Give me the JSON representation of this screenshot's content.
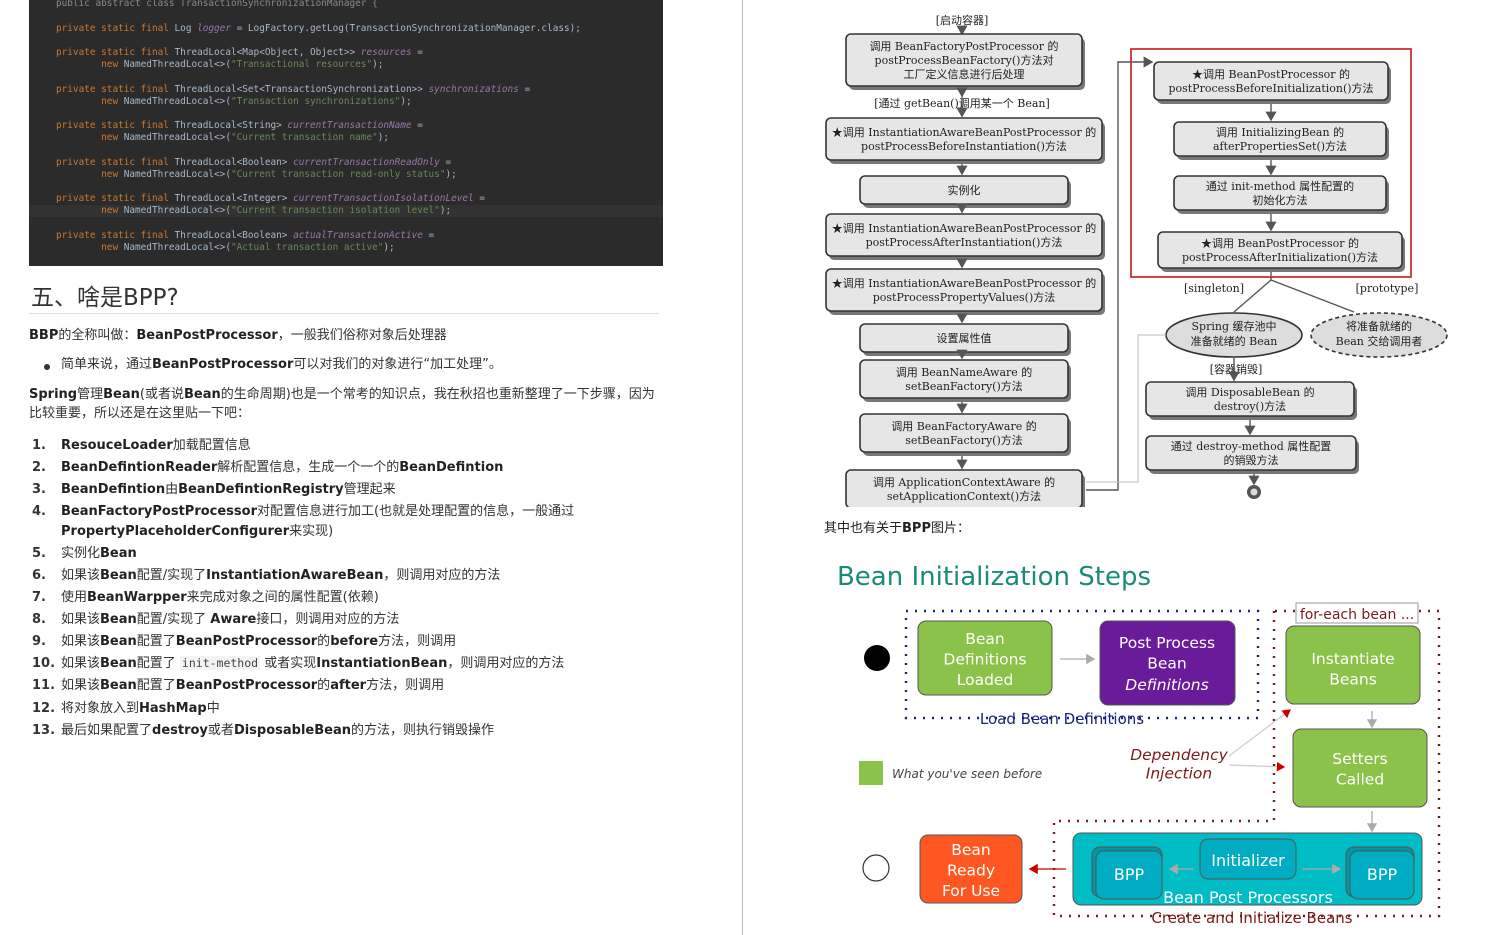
{
  "code": {
    "top_line": "public abstract class TransactionSynchronizationManager {",
    "lines": [
      [
        "private static final",
        "Log",
        "logger",
        "= LogFactory.getLog(TransactionSynchronizationManager.class);",
        ""
      ],
      [
        "private static final",
        "ThreadLocal<Map<Object, Object>>",
        "resources",
        "=",
        "new NamedThreadLocal<>(\"Transactional resources\");"
      ],
      [
        "private static final",
        "ThreadLocal<Set<TransactionSynchronization>>",
        "synchronizations",
        "=",
        "new NamedThreadLocal<>(\"Transaction synchronizations\");"
      ],
      [
        "private static final",
        "ThreadLocal<String>",
        "currentTransactionName",
        "=",
        "new NamedThreadLocal<>(\"Current transaction name\");"
      ],
      [
        "private static final",
        "ThreadLocal<Boolean>",
        "currentTransactionReadOnly",
        "=",
        "new NamedThreadLocal<>(\"Current transaction read-only status\");"
      ],
      [
        "private static final",
        "ThreadLocal<Integer>",
        "currentTransactionIsolationLevel",
        "=",
        "new NamedThreadLocal<>(\"Current transaction isolation level\");"
      ],
      [
        "private static final",
        "ThreadLocal<Boolean>",
        "actualTransactionActive",
        "=",
        "new NamedThreadLocal<>(\"Actual transaction active\");"
      ]
    ]
  },
  "heading": "五、啥是BPP?",
  "intro": {
    "bbp": "BBP",
    "t1": "的全称叫做：",
    "bpp": "BeanPostProcessor",
    "t2": "，一般我们俗称对象后处理器"
  },
  "bullet": {
    "t1": "简单来说，通过",
    "bpp": "BeanPostProcessor",
    "t2": "可以对我们的对象进行“加工处理”。"
  },
  "para": {
    "spring": "Spring",
    "t1": "管理",
    "bean": "Bean",
    "t2": "(或者说",
    "bean2": "Bean",
    "t3": "的生命周期)也是一个常考的知识点，我在秋招也重新整理了一下步骤，因为比较重要，所以还是在这里贴一下吧："
  },
  "steps": [
    {
      "n": "1.",
      "parts": [
        [
          "b",
          "ResouceLoader"
        ],
        [
          "t",
          "加载配置信息"
        ]
      ]
    },
    {
      "n": "2.",
      "parts": [
        [
          "b",
          "BeanDefintionReader"
        ],
        [
          "t",
          "解析配置信息，生成一个一个的"
        ],
        [
          "b",
          "BeanDefintion"
        ]
      ]
    },
    {
      "n": "3.",
      "parts": [
        [
          "b",
          "BeanDefintion"
        ],
        [
          "t",
          "由"
        ],
        [
          "b",
          "BeanDefintionRegistry"
        ],
        [
          "t",
          "管理起来"
        ]
      ]
    },
    {
      "n": "4.",
      "parts": [
        [
          "b",
          "BeanFactoryPostProcessor"
        ],
        [
          "t",
          "对配置信息进行加工(也就是处理配置的信息，一般通过"
        ],
        [
          "b",
          "PropertyPlaceholderConfigurer"
        ],
        [
          "t",
          "来实现)"
        ]
      ]
    },
    {
      "n": "5.",
      "parts": [
        [
          "t",
          "实例化"
        ],
        [
          "b",
          "Bean"
        ]
      ]
    },
    {
      "n": "6.",
      "parts": [
        [
          "t",
          "如果该"
        ],
        [
          "b",
          "Bean"
        ],
        [
          "t",
          "配置/实现了"
        ],
        [
          "b",
          "InstantiationAwareBean"
        ],
        [
          "t",
          "，则调用对应的方法"
        ]
      ]
    },
    {
      "n": "7.",
      "parts": [
        [
          "t",
          "使用"
        ],
        [
          "b",
          "BeanWarpper"
        ],
        [
          "t",
          "来完成对象之间的属性配置(依赖)"
        ]
      ]
    },
    {
      "n": "8.",
      "parts": [
        [
          "t",
          "如果该"
        ],
        [
          "b",
          "Bean"
        ],
        [
          "t",
          "配置/实现了 "
        ],
        [
          "b",
          "Aware"
        ],
        [
          "t",
          "接口，则调用对应的方法"
        ]
      ]
    },
    {
      "n": "9.",
      "parts": [
        [
          "t",
          "如果该"
        ],
        [
          "b",
          "Bean"
        ],
        [
          "t",
          "配置了"
        ],
        [
          "b",
          "BeanPostProcessor"
        ],
        [
          "t",
          "的"
        ],
        [
          "b",
          "before"
        ],
        [
          "t",
          "方法，则调用"
        ]
      ]
    },
    {
      "n": "10.",
      "parts": [
        [
          "t",
          "如果该"
        ],
        [
          "b",
          "Bean"
        ],
        [
          "t",
          "配置了 "
        ],
        [
          "c",
          "init-method"
        ],
        [
          "t",
          " 或者实现"
        ],
        [
          "b",
          "InstantiationBean"
        ],
        [
          "t",
          "，则调用对应的方法"
        ]
      ]
    },
    {
      "n": "11.",
      "parts": [
        [
          "t",
          "如果该"
        ],
        [
          "b",
          "Bean"
        ],
        [
          "t",
          "配置了"
        ],
        [
          "b",
          "BeanPostProcessor"
        ],
        [
          "t",
          "的"
        ],
        [
          "b",
          "after"
        ],
        [
          "t",
          "方法，则调用"
        ]
      ]
    },
    {
      "n": "12.",
      "parts": [
        [
          "t",
          "将对象放入到"
        ],
        [
          "b",
          "HashMap"
        ],
        [
          "t",
          "中"
        ]
      ]
    },
    {
      "n": "13.",
      "parts": [
        [
          "t",
          "最后如果配置了"
        ],
        [
          "b",
          "destroy"
        ],
        [
          "t",
          "或者"
        ],
        [
          "b",
          "DisposableBean"
        ],
        [
          "t",
          "的方法，则执行销毁操作"
        ]
      ]
    }
  ],
  "flow": {
    "start": "[启动容器]",
    "left": [
      "调用 BeanFactoryPostProcessor 的|postProcessBeanFactory()方法对|工厂定义信息进行后处理",
      "★调用 InstantiationAwareBeanPostProcessor 的|postProcessBeforeInstantiation()方法",
      "实例化",
      "★调用 InstantiationAwareBeanPostProcessor 的|postProcessAfterInstantiation()方法",
      "★调用 InstantiationAwareBeanPostProcessor 的|postProcessPropertyValues()方法",
      "设置属性值",
      "调用 BeanNameAware 的|setBeanFactory()方法",
      "调用 BeanFactoryAware 的|setBeanFactory()方法",
      "调用 ApplicationContextAware 的|setApplicationContext()方法"
    ],
    "getbean": "[通过 getBean()调用某一个 Bean]",
    "right": [
      "★调用 BeanPostProcessor 的|postProcessBeforeInitialization()方法",
      "调用 InitializingBean 的|afterPropertiesSet()方法",
      "通过 init-method 属性配置的|初始化方法",
      "★调用 BeanPostProcessor 的|postProcessAfterInitialization()方法"
    ],
    "singleton": "[singleton]",
    "prototype": "[prototype]",
    "pool": "Spring 缓存池中|准备就绪的 Bean",
    "deliver": "将准备就绪的|Bean 交给调用者",
    "destroy_label": "[容器销毁]",
    "bottom": [
      "调用 DisposableBean 的|destroy()方法",
      "通过 destroy-method 属性配置|的销毁方法"
    ]
  },
  "caption": {
    "t1": "其中也有关于",
    "bpp": "BPP",
    "t2": "图片："
  },
  "init": {
    "title": "Bean Initialization Steps",
    "defs_loaded": "Bean|Definitions|Loaded",
    "post_process": "Post Process|Bean",
    "definitions": "Definitions",
    "load_label": "Load Bean Definitions",
    "foreach": "for-each bean ...",
    "instantiate": "Instantiate|Beans",
    "setters": "Setters|Called",
    "di": "Dependency|Injection",
    "seen": "What you've seen before",
    "ready": "Bean|Ready|For Use",
    "bpp1": "BPP",
    "initializer": "Initializer",
    "bpp2": "BPP",
    "bpps": "Bean Post Processors",
    "create": "Create and Initialize Beans",
    "colors": {
      "green": "#8bc34a",
      "purple": "#6a1b9a",
      "orange": "#ff5722",
      "teal": "#00bcc4",
      "title": "#1b8a7a",
      "navy": "#1a237e",
      "maroon": "#7b1a1a"
    }
  }
}
